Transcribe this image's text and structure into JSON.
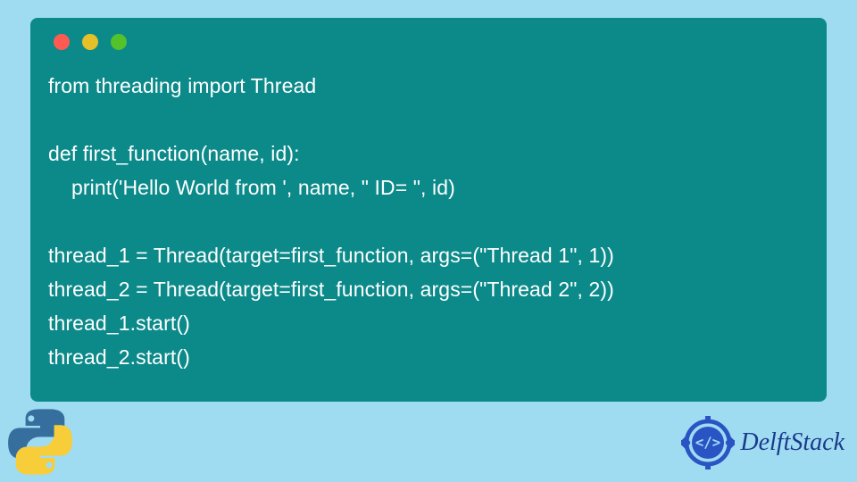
{
  "window": {
    "dots": [
      "red",
      "yellow",
      "green"
    ]
  },
  "code": {
    "lines": [
      "from threading import Thread",
      "",
      "def first_function(name, id):",
      "    print('Hello World from ', name, \" ID= \", id)",
      "",
      "thread_1 = Thread(target=first_function, args=(\"Thread 1\", 1))",
      "thread_2 = Thread(target=first_function, args=(\"Thread 2\", 2))",
      "thread_1.start()",
      "thread_2.start()"
    ]
  },
  "brand": {
    "name": "DelftStack"
  },
  "icons": {
    "python": "python-logo",
    "delft": "delft-gear"
  },
  "colors": {
    "page_bg": "#9fdcf2",
    "card_bg": "#0c8a8a",
    "code_text": "#ffffff",
    "brand_text": "#1b3a8a"
  }
}
